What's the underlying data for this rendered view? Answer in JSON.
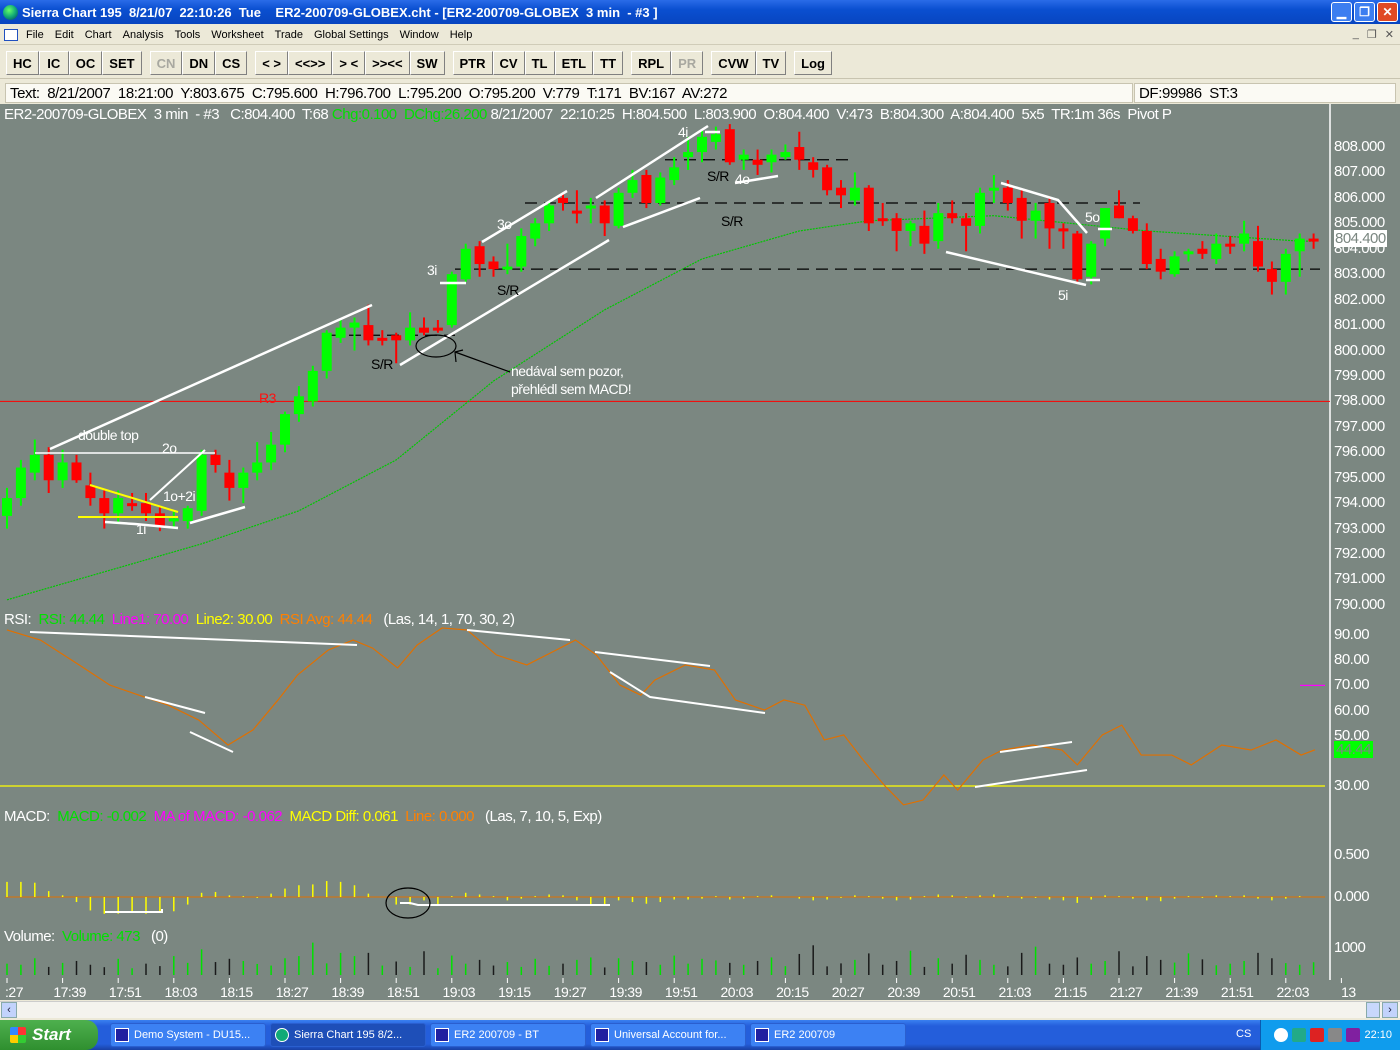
{
  "window": {
    "title": "Sierra Chart 195  8/21/07  22:10:26  Tue    ER2-200709-GLOBEX.cht - [ER2-200709-GLOBEX  3 min  - #3 ]"
  },
  "menu": [
    "File",
    "Edit",
    "Chart",
    "Analysis",
    "Tools",
    "Worksheet",
    "Trade",
    "Global Settings",
    "Window",
    "Help"
  ],
  "toolbar": [
    [
      "HC",
      "IC",
      "OC",
      "SET"
    ],
    [
      "CN",
      "DN",
      "CS"
    ],
    [
      "< >",
      "<<>>",
      "> <",
      ">><<",
      "SW"
    ],
    [
      "PTR",
      "CV",
      "TL",
      "ETL",
      "TT"
    ],
    [
      "RPL",
      "PR"
    ],
    [
      "CVW",
      "TV"
    ],
    [
      "Log"
    ]
  ],
  "toolbar_disabled": [
    "CN",
    "PR"
  ],
  "infobar": {
    "text": "Text:  8/21/2007  18:21:00  Y:803.675  C:795.600  H:796.700  L:795.200  O:795.200  V:779  T:171  BV:167  AV:272",
    "right": "DF:99986  ST:3"
  },
  "chart_header": {
    "a": "ER2-200709-GLOBEX  3 min  - #3   C:804.400  T:68 ",
    "chg": "Chg:0.100  DChg:26.200",
    "b": " 8/21/2007  22:10:25  H:804.500  L:803.900  O:804.400  V:473  B:804.300  A:804.400  5x5  TR:1m 36s  Pivot P"
  },
  "colors": {
    "background": "#7b8781",
    "up": "#00ff00",
    "down": "#ff0000",
    "ma": "#00c800",
    "rsi": "#e07000",
    "line2": "#ffff00",
    "line1": "#ff00ff",
    "macd_hist": "#ffff00",
    "r3": "#ff0000"
  },
  "chart_data": [
    {
      "type": "candlestick",
      "symbol": "ER2-200709-GLOBEX",
      "interval": "3 min",
      "time_start": "17:27",
      "ylim": [
        789.5,
        809
      ],
      "ohlc": [
        [
          793.5,
          794.6,
          793.0,
          794.2
        ],
        [
          794.2,
          795.7,
          793.9,
          795.4
        ],
        [
          795.2,
          796.5,
          794.9,
          795.9
        ],
        [
          795.9,
          796.2,
          794.4,
          794.9
        ],
        [
          794.9,
          796.1,
          794.6,
          795.6
        ],
        [
          795.6,
          795.9,
          794.8,
          794.9
        ],
        [
          794.7,
          795.2,
          793.9,
          794.2
        ],
        [
          794.2,
          794.5,
          793.0,
          793.6
        ],
        [
          793.6,
          794.5,
          793.2,
          794.2
        ],
        [
          794.0,
          794.4,
          793.7,
          794.0
        ],
        [
          794.0,
          794.4,
          793.3,
          793.6
        ],
        [
          793.6,
          793.9,
          792.9,
          793.1
        ],
        [
          793.3,
          793.7,
          793.0,
          793.4
        ],
        [
          793.3,
          793.9,
          793.0,
          793.8
        ],
        [
          793.7,
          796.1,
          793.5,
          795.9
        ],
        [
          795.9,
          796.1,
          795.2,
          795.5
        ],
        [
          795.2,
          795.7,
          794.1,
          794.6
        ],
        [
          794.6,
          795.4,
          794.0,
          795.2
        ],
        [
          795.2,
          796.4,
          794.9,
          795.6
        ],
        [
          795.6,
          796.8,
          795.3,
          796.3
        ],
        [
          796.3,
          797.6,
          796.0,
          797.5
        ],
        [
          797.5,
          798.6,
          797.2,
          798.2
        ],
        [
          798.0,
          799.4,
          797.8,
          799.2
        ],
        [
          799.2,
          800.8,
          798.9,
          800.7
        ],
        [
          800.5,
          801.2,
          800.3,
          800.9
        ],
        [
          800.9,
          801.3,
          800.0,
          801.1
        ],
        [
          801.0,
          801.8,
          800.2,
          800.4
        ],
        [
          800.5,
          800.8,
          800.2,
          800.5
        ],
        [
          800.6,
          800.7,
          799.5,
          800.4
        ],
        [
          800.4,
          801.5,
          800.2,
          800.9
        ],
        [
          800.9,
          801.3,
          800.6,
          800.7
        ],
        [
          800.9,
          801.2,
          800.7,
          800.9
        ],
        [
          801.0,
          803.1,
          800.9,
          803.0
        ],
        [
          802.8,
          804.2,
          802.7,
          804.0
        ],
        [
          804.1,
          804.3,
          802.9,
          803.4
        ],
        [
          803.5,
          803.7,
          802.9,
          803.2
        ],
        [
          803.2,
          804.2,
          803.0,
          803.3
        ],
        [
          803.3,
          804.8,
          803.1,
          804.5
        ],
        [
          804.4,
          805.2,
          804.1,
          805.0
        ],
        [
          805.0,
          805.9,
          804.7,
          805.7
        ],
        [
          806.0,
          806.2,
          805.5,
          805.8
        ],
        [
          805.5,
          806.3,
          805.0,
          805.5
        ],
        [
          805.6,
          806.0,
          805.0,
          805.7
        ],
        [
          805.7,
          805.9,
          804.5,
          805.0
        ],
        [
          804.9,
          806.4,
          804.8,
          806.2
        ],
        [
          806.2,
          807.1,
          806.0,
          806.7
        ],
        [
          806.9,
          807.1,
          805.6,
          805.8
        ],
        [
          805.8,
          807.0,
          805.7,
          806.8
        ],
        [
          806.7,
          807.6,
          806.5,
          807.2
        ],
        [
          807.6,
          808.4,
          807.1,
          807.8
        ],
        [
          807.8,
          808.7,
          807.4,
          808.4
        ],
        [
          808.2,
          808.8,
          807.9,
          808.5
        ],
        [
          808.7,
          808.9,
          807.3,
          807.4
        ],
        [
          807.5,
          807.9,
          807.1,
          807.7
        ],
        [
          807.5,
          807.9,
          806.9,
          807.3
        ],
        [
          807.4,
          807.9,
          807.0,
          807.7
        ],
        [
          807.6,
          808.1,
          807.5,
          807.8
        ],
        [
          808.0,
          808.6,
          807.1,
          807.5
        ],
        [
          807.4,
          807.6,
          806.8,
          807.1
        ],
        [
          807.2,
          807.3,
          806.1,
          806.3
        ],
        [
          806.4,
          806.7,
          805.6,
          806.1
        ],
        [
          805.9,
          807.0,
          805.7,
          806.4
        ],
        [
          806.4,
          806.5,
          804.7,
          805.0
        ],
        [
          805.2,
          805.8,
          804.9,
          805.1
        ],
        [
          805.2,
          805.4,
          803.9,
          804.7
        ],
        [
          804.7,
          805.1,
          804.1,
          805.0
        ],
        [
          804.9,
          805.5,
          803.8,
          804.2
        ],
        [
          804.3,
          805.8,
          804.0,
          805.4
        ],
        [
          805.4,
          805.9,
          805.0,
          805.2
        ],
        [
          805.2,
          805.4,
          803.9,
          804.9
        ],
        [
          804.9,
          806.4,
          804.6,
          806.2
        ],
        [
          806.3,
          806.9,
          805.8,
          806.4
        ],
        [
          806.4,
          806.7,
          805.5,
          805.8
        ],
        [
          806.0,
          806.3,
          804.4,
          805.1
        ],
        [
          805.1,
          805.8,
          804.4,
          805.5
        ],
        [
          805.8,
          806.0,
          804.0,
          804.8
        ],
        [
          804.8,
          805.0,
          804.0,
          804.7
        ],
        [
          804.6,
          804.7,
          802.7,
          802.8
        ],
        [
          802.9,
          804.3,
          802.6,
          804.2
        ],
        [
          804.4,
          805.6,
          804.1,
          805.6
        ],
        [
          805.7,
          806.3,
          805.2,
          805.2
        ],
        [
          805.2,
          805.3,
          804.6,
          804.7
        ],
        [
          804.7,
          805.0,
          803.2,
          803.4
        ],
        [
          803.6,
          804.0,
          802.8,
          803.1
        ],
        [
          803.0,
          803.9,
          802.9,
          803.7
        ],
        [
          803.8,
          804.0,
          803.5,
          803.9
        ],
        [
          804.0,
          804.3,
          803.6,
          803.8
        ],
        [
          803.6,
          804.6,
          803.4,
          804.2
        ],
        [
          804.2,
          804.5,
          803.8,
          804.2
        ],
        [
          804.2,
          805.1,
          803.9,
          804.6
        ],
        [
          804.3,
          804.9,
          803.1,
          803.3
        ],
        [
          803.2,
          803.5,
          802.2,
          802.7
        ],
        [
          802.7,
          804.0,
          802.2,
          803.8
        ],
        [
          803.9,
          804.6,
          802.9,
          804.4
        ],
        [
          804.4,
          804.6,
          804.0,
          804.4
        ]
      ],
      "moving_average": [
        [
          0,
          790.2
        ],
        [
          14,
          792.4
        ],
        [
          21,
          793.7
        ],
        [
          28,
          795.7
        ],
        [
          35,
          798.8
        ],
        [
          43,
          801.6
        ],
        [
          50,
          803.6
        ],
        [
          57,
          804.7
        ],
        [
          62,
          805.1
        ],
        [
          71,
          805.3
        ],
        [
          82,
          804.7
        ],
        [
          93,
          804.3
        ],
        [
          94,
          804.3
        ]
      ],
      "r3_level": 798.0,
      "sr_levels": [
        800.6,
        803.2,
        805.8,
        807.5
      ],
      "last_price": "804.400",
      "y_ticks": [
        "808.000",
        "807.000",
        "806.000",
        "805.000",
        "804.000",
        "803.000",
        "802.000",
        "801.000",
        "800.000",
        "799.000",
        "798.000",
        "797.000",
        "796.000",
        "795.000",
        "794.000",
        "793.000",
        "792.000",
        "791.000",
        "790.000"
      ],
      "x_ticks": [
        ":27",
        "17:39",
        "17:51",
        "18:03",
        "18:15",
        "18:27",
        "18:39",
        "18:51",
        "19:03",
        "19:15",
        "19:27",
        "19:39",
        "19:51",
        "20:03",
        "20:15",
        "20:27",
        "20:39",
        "20:51",
        "21:03",
        "21:15",
        "21:27",
        "21:39",
        "21:51",
        "22:03",
        "13"
      ],
      "annotations": {
        "double_top": "double top",
        "2o": "2o",
        "1o2i": "1o+2i",
        "1i": "1i",
        "r3": "R3",
        "sr": "S/R",
        "3i": "3i",
        "3o": "3o",
        "4i": "4i",
        "4o": "4o",
        "5o": "5o",
        "5i": "5i",
        "note1": "nedával sem pozor,",
        "note2": "přehlédl sem MACD!"
      }
    },
    {
      "type": "line",
      "study": "RSI",
      "ylim": [
        20,
        95
      ],
      "line1": 70,
      "line2": 30,
      "last": "44.44",
      "y_ticks": [
        "90.00",
        "80.00",
        "70.00",
        "60.00",
        "50.00",
        "30.00"
      ],
      "points": [
        [
          0,
          92
        ],
        [
          2.4,
          88
        ],
        [
          5.2,
          78.1
        ],
        [
          7.4,
          70.1
        ],
        [
          9.5,
          66.1
        ],
        [
          11.6,
          62.1
        ],
        [
          13.8,
          56.2
        ],
        [
          15.9,
          46.3
        ],
        [
          17.7,
          52.3
        ],
        [
          19.5,
          64.2
        ],
        [
          20.9,
          74.1
        ],
        [
          23.1,
          84
        ],
        [
          24.9,
          88
        ],
        [
          26.3,
          84.8
        ],
        [
          28.1,
          76.9
        ],
        [
          29.5,
          86
        ],
        [
          31.3,
          92.8
        ],
        [
          33.1,
          92
        ],
        [
          35.2,
          82.1
        ],
        [
          37.4,
          78.1
        ],
        [
          39.5,
          84
        ],
        [
          40.9,
          88
        ],
        [
          42.4,
          82.1
        ],
        [
          44.1,
          70.1
        ],
        [
          45.6,
          66.1
        ],
        [
          46.6,
          72.1
        ],
        [
          48.8,
          78.1
        ],
        [
          50.9,
          76.1
        ],
        [
          52.4,
          64.2
        ],
        [
          54.5,
          60.2
        ],
        [
          55.9,
          64.2
        ],
        [
          57.4,
          62.1
        ],
        [
          58.8,
          48.3
        ],
        [
          60.2,
          50.3
        ],
        [
          61.6,
          40.3
        ],
        [
          63.1,
          30.4
        ],
        [
          64.5,
          22.5
        ],
        [
          65.9,
          24.4
        ],
        [
          67.4,
          34.4
        ],
        [
          68.4,
          28.4
        ],
        [
          70.2,
          40.3
        ],
        [
          71.6,
          44.3
        ],
        [
          73.8,
          46.3
        ],
        [
          75.9,
          44.3
        ],
        [
          77,
          38.4
        ],
        [
          78.8,
          50.3
        ],
        [
          80.2,
          54.2
        ],
        [
          81.6,
          42.3
        ],
        [
          83.8,
          42.3
        ],
        [
          85.2,
          38.4
        ],
        [
          87.4,
          46.3
        ],
        [
          89.5,
          44.3
        ],
        [
          91.3,
          48.3
        ],
        [
          93.1,
          42.3
        ],
        [
          94.1,
          44.4
        ]
      ]
    },
    {
      "type": "bar",
      "study": "MACD",
      "y_ticks": [
        "0.500",
        "0.000"
      ],
      "histogram": [
        0.18,
        0.18,
        0.17,
        0.07,
        0.02,
        -0.06,
        -0.16,
        -0.2,
        -0.2,
        -0.19,
        -0.2,
        -0.19,
        -0.17,
        -0.09,
        0.05,
        0.06,
        0.02,
        0.01,
        -0.01,
        0.04,
        0.1,
        0.14,
        0.15,
        0.19,
        0.18,
        0.14,
        0.04,
        0.0,
        -0.09,
        -0.09,
        -0.04,
        -0.09,
        0.01,
        0.05,
        0.03,
        0.01,
        -0.04,
        -0.02,
        0.01,
        0.03,
        0.02,
        -0.04,
        -0.09,
        -0.09,
        -0.04,
        -0.06,
        -0.08,
        -0.06,
        -0.03,
        -0.03,
        -0.02,
        0.01,
        -0.03,
        -0.02,
        0.01,
        0.02,
        0.0,
        -0.02,
        -0.04,
        -0.03,
        -0.01,
        0.02,
        0.01,
        -0.02,
        -0.04,
        -0.03,
        0.01,
        0.03,
        0.02,
        -0.01,
        0.02,
        0.03,
        0.01,
        -0.02,
        -0.01,
        -0.03,
        -0.04,
        -0.07,
        -0.03,
        0.02,
        0.01,
        -0.02,
        -0.04,
        -0.05,
        -0.02,
        0.01,
        -0.01,
        0.02,
        0.01,
        0.02,
        -0.02,
        -0.04,
        -0.02,
        0.01,
        0.0
      ]
    },
    {
      "type": "bar",
      "study": "Volume",
      "last": "473",
      "y_ticks": [
        "1000"
      ],
      "values": [
        420,
        380,
        620,
        300,
        450,
        520,
        380,
        290,
        600,
        250,
        420,
        330,
        700,
        450,
        950,
        480,
        600,
        520,
        410,
        350,
        620,
        700,
        1200,
        430,
        820,
        700,
        820,
        350,
        500,
        300,
        880,
        250,
        720,
        420,
        560,
        350,
        480,
        300,
        600,
        340,
        420,
        560,
        650,
        280,
        620,
        520,
        480,
        380,
        720,
        420,
        600,
        540,
        450,
        380,
        520,
        650,
        330,
        780,
        1100,
        320,
        430,
        560,
        800,
        380,
        520,
        900,
        300,
        620,
        420,
        750,
        560,
        380,
        320,
        820,
        1050,
        420,
        380,
        650,
        420,
        520,
        880,
        320,
        700,
        560,
        460,
        800,
        580,
        360,
        420,
        520,
        820,
        620,
        440,
        380,
        473
      ]
    }
  ],
  "studies": {
    "rsi": {
      "label": "RSI:",
      "rsi": "RSI: 44.44",
      "line1": "Line1: 70.00",
      "line2": "Line2: 30.00",
      "avg": "RSI Avg: 44.44",
      "params": "(Las, 14, 1, 70, 30, 2)"
    },
    "macd": {
      "label": "MACD:",
      "macd": "MACD: -0.002",
      "ma": "MA of MACD: -0.062",
      "diff": "MACD Diff: 0.061",
      "line": "Line: 0.000",
      "params": "(Las, 7, 10, 5, Exp)"
    },
    "volume": {
      "label": "Volume:",
      "value": "Volume: 473",
      "params": "(0)"
    }
  },
  "taskbar": {
    "start": "Start",
    "tasks": [
      "Demo System - DU15...",
      "Sierra Chart 195  8/2...",
      "ER2 200709 - BT",
      "Universal Account for...",
      "ER2  200709"
    ],
    "lang": "CS",
    "clock": "22:10"
  }
}
